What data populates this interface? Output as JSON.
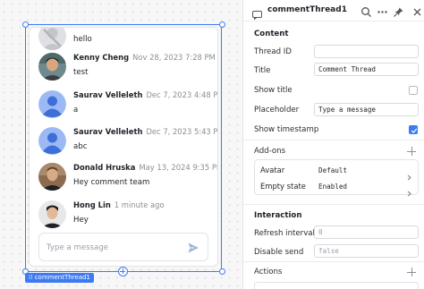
{
  "canvas": {
    "messages": [
      {
        "name": "",
        "time": "",
        "text": "hello",
        "avatar": "partial"
      },
      {
        "name": "Kenny Cheng",
        "time": "Nov 28, 2023 7:28 PM",
        "text": "test",
        "avatar": "photo"
      },
      {
        "name": "Saurav Velleleth",
        "time": "Dec 7, 2023 4:48 PM",
        "text": "a",
        "avatar": "default"
      },
      {
        "name": "Saurav Velleleth",
        "time": "Dec 7, 2023 5:43 PM",
        "text": "abc",
        "avatar": "default"
      },
      {
        "name": "Donald Hruska",
        "time": "May 13, 2024 9:35 PM",
        "text": "Hey comment team",
        "avatar": "photo"
      },
      {
        "name": "Hong Lin",
        "time": "1 minute ago",
        "text": "Hey",
        "avatar": "photo"
      }
    ],
    "composer_placeholder": "Type a message",
    "component_tag": "commentThread1"
  },
  "inspector": {
    "title": "commentThread1",
    "sections": {
      "content": "Content",
      "addons": "Add-ons",
      "interaction": "Interaction",
      "actions": "Actions"
    },
    "fields": {
      "thread_id_label": "Thread ID",
      "thread_id_value": "",
      "title_label": "Title",
      "title_value": "Comment Thread",
      "show_title_label": "Show title",
      "show_title_checked": false,
      "placeholder_label": "Placeholder",
      "placeholder_value": "Type a message",
      "show_timestamp_label": "Show timestamp",
      "show_timestamp_checked": true,
      "refresh_label": "Refresh interval",
      "refresh_placeholder": "0",
      "disable_send_label": "Disable send",
      "disable_send_placeholder": "false"
    },
    "addons": [
      {
        "name": "Avatar",
        "value": "Default"
      },
      {
        "name": "Empty state",
        "value": "Enabled"
      }
    ]
  },
  "colors": {
    "accent": "#3d7bf4",
    "avatar_default": "#9cb9f5"
  }
}
